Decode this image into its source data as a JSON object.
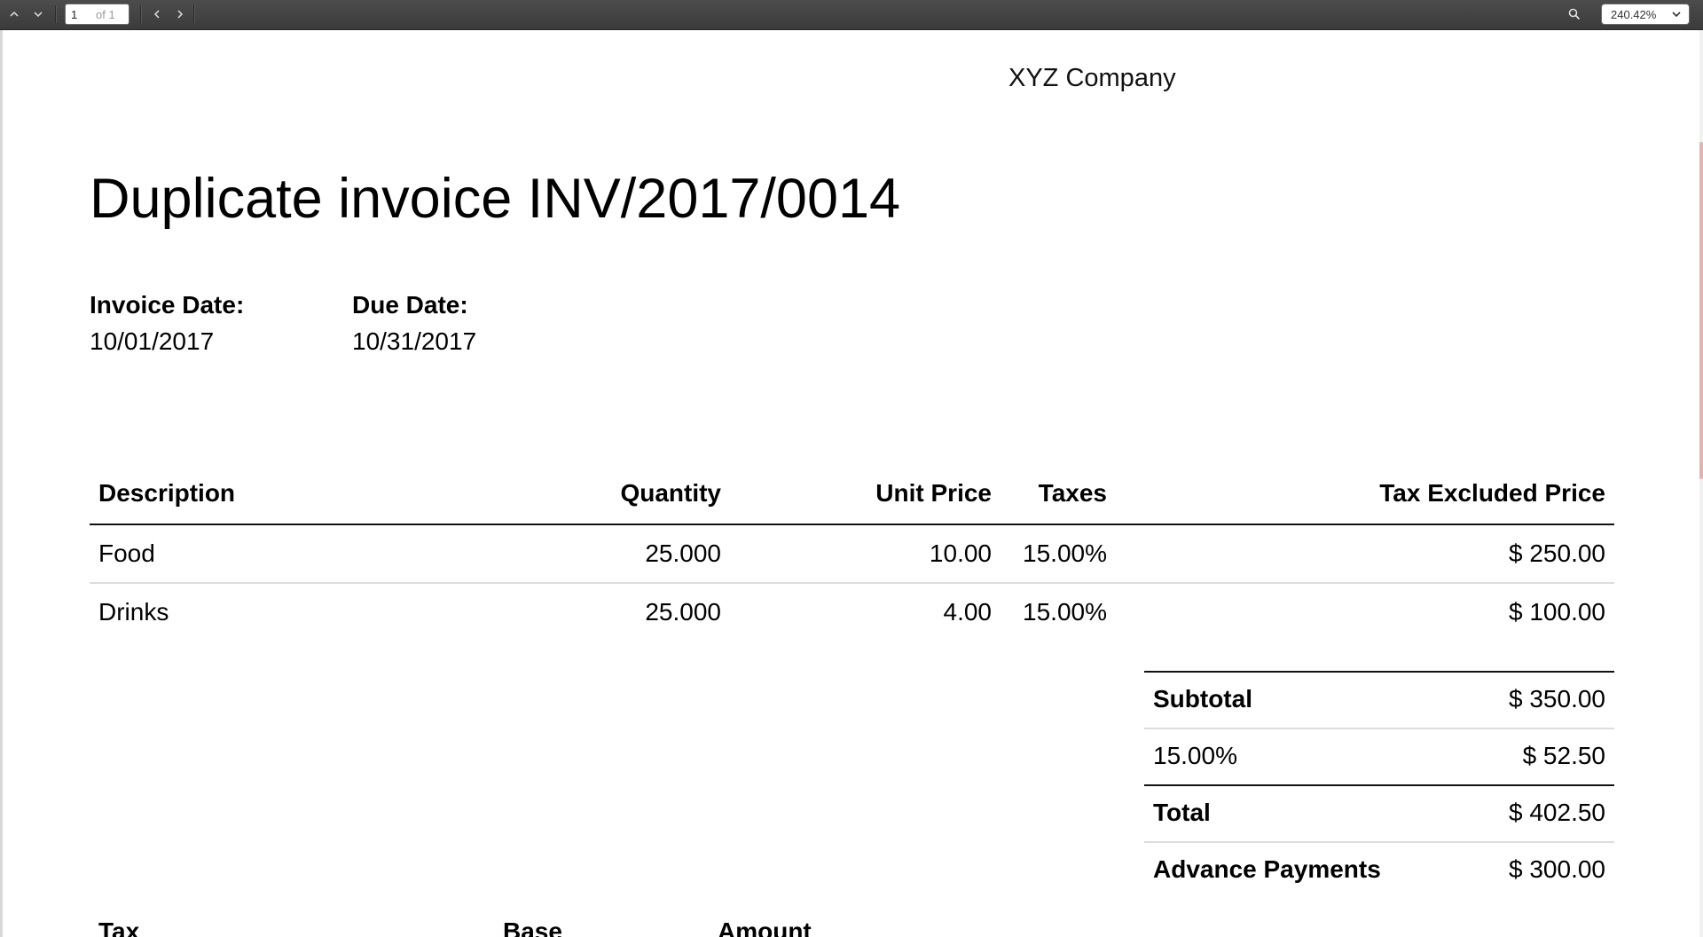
{
  "toolbar": {
    "page_number": "1",
    "page_of": "of 1",
    "zoom": "240.42%"
  },
  "document": {
    "company": "XYZ Company",
    "title": "Duplicate invoice INV/2017/0014",
    "invoice_date_label": "Invoice Date:",
    "invoice_date": "10/01/2017",
    "due_date_label": "Due Date:",
    "due_date": "10/31/2017",
    "columns": [
      "Description",
      "Quantity",
      "Unit Price",
      "Taxes",
      "Tax Excluded Price"
    ],
    "lines": [
      {
        "description": "Food",
        "quantity": "25.000",
        "unit_price": "10.00",
        "taxes": "15.00%",
        "price": "$ 250.00"
      },
      {
        "description": "Drinks",
        "quantity": "25.000",
        "unit_price": "4.00",
        "taxes": "15.00%",
        "price": "$ 100.00"
      }
    ],
    "totals": {
      "subtotal_label": "Subtotal",
      "subtotal": "$ 350.00",
      "tax_label": "15.00%",
      "tax": "$ 52.50",
      "total_label": "Total",
      "total": "$ 402.50",
      "advance_label": "Advance Payments",
      "advance": "$ 300.00"
    },
    "tax_table_columns": [
      "Tax",
      "Base",
      "Amount"
    ]
  }
}
